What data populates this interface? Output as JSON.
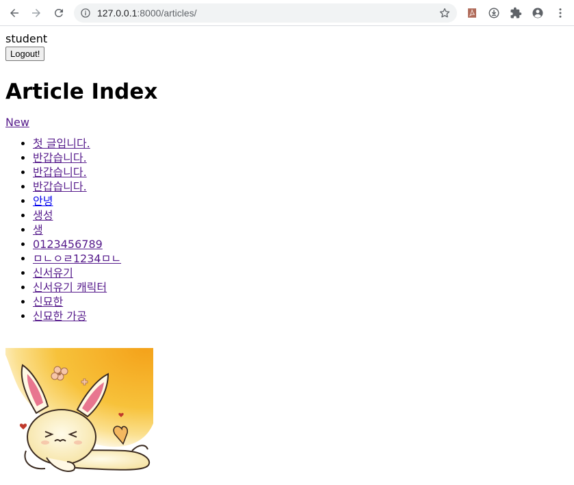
{
  "browser": {
    "url_host": "127.0.0.1",
    "url_path": ":8000/articles/"
  },
  "page": {
    "username": "student",
    "logout_label": "Logout!",
    "title": "Article Index",
    "new_link": "New",
    "articles": [
      {
        "title": "첫 글입니다.",
        "visited": true
      },
      {
        "title": "반갑습니다.",
        "visited": true
      },
      {
        "title": "반갑습니다.",
        "visited": true
      },
      {
        "title": "반갑습니다.",
        "visited": true
      },
      {
        "title": "안녕",
        "visited": false
      },
      {
        "title": "생성",
        "visited": true
      },
      {
        "title": "생",
        "visited": true
      },
      {
        "title": "0123456789",
        "visited": true
      },
      {
        "title": "ㅁㄴㅇㄹ1234ㅁㄴ",
        "visited": true
      },
      {
        "title": "신서유기",
        "visited": true
      },
      {
        "title": "신서유기 캐릭터",
        "visited": true
      },
      {
        "title": "신묘한",
        "visited": true
      },
      {
        "title": "신묘한 가공",
        "visited": true
      }
    ]
  },
  "colors": {
    "visited_link": "#551a8b",
    "unvisited_link": "#0000ee"
  },
  "icons": [
    "back-arrow-icon",
    "forward-arrow-icon",
    "reload-icon",
    "info-icon",
    "bookmark-star-icon",
    "pdf-extension-icon",
    "download-extension-icon",
    "extensions-puzzle-icon",
    "profile-avatar-icon",
    "more-menu-icon",
    "bunny-character-image"
  ]
}
